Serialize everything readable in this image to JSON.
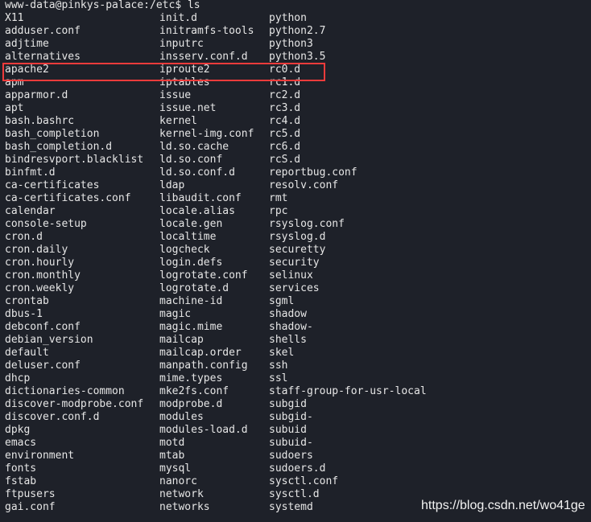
{
  "terminal": {
    "prompt": "www-data@pinkys-palace:/etc$ ls",
    "columns": [
      [
        "X11",
        "adduser.conf",
        "adjtime",
        "alternatives",
        "apache2",
        "apm",
        "apparmor.d",
        "apt",
        "bash.bashrc",
        "bash_completion",
        "bash_completion.d",
        "bindresvport.blacklist",
        "binfmt.d",
        "ca-certificates",
        "ca-certificates.conf",
        "calendar",
        "console-setup",
        "cron.d",
        "cron.daily",
        "cron.hourly",
        "cron.monthly",
        "cron.weekly",
        "crontab",
        "dbus-1",
        "debconf.conf",
        "debian_version",
        "default",
        "deluser.conf",
        "dhcp",
        "dictionaries-common",
        "discover-modprobe.conf",
        "discover.conf.d",
        "dpkg",
        "emacs",
        "environment",
        "fonts",
        "fstab",
        "ftpusers",
        "gai.conf"
      ],
      [
        "init.d",
        "initramfs-tools",
        "inputrc",
        "insserv.conf.d",
        "iproute2",
        "iptables",
        "issue",
        "issue.net",
        "kernel",
        "kernel-img.conf",
        "ld.so.cache",
        "ld.so.conf",
        "ld.so.conf.d",
        "ldap",
        "libaudit.conf",
        "locale.alias",
        "locale.gen",
        "localtime",
        "logcheck",
        "login.defs",
        "logrotate.conf",
        "logrotate.d",
        "machine-id",
        "magic",
        "magic.mime",
        "mailcap",
        "mailcap.order",
        "manpath.config",
        "mime.types",
        "mke2fs.conf",
        "modprobe.d",
        "modules",
        "modules-load.d",
        "motd",
        "mtab",
        "mysql",
        "nanorc",
        "network",
        "networks"
      ],
      [
        "python",
        "python2.7",
        "python3",
        "python3.5",
        "rc0.d",
        "rc1.d",
        "rc2.d",
        "rc3.d",
        "rc4.d",
        "rc5.d",
        "rc6.d",
        "rcS.d",
        "reportbug.conf",
        "resolv.conf",
        "rmt",
        "rpc",
        "rsyslog.conf",
        "rsyslog.d",
        "securetty",
        "security",
        "selinux",
        "services",
        "sgml",
        "shadow",
        "shadow-",
        "shells",
        "skel",
        "ssh",
        "ssl",
        "staff-group-for-usr-local",
        "subgid",
        "subgid-",
        "subuid",
        "subuid-",
        "sudoers",
        "sudoers.d",
        "sysctl.conf",
        "sysctl.d",
        "systemd"
      ]
    ],
    "highlighted_row": 3,
    "highlight_color": "#ef3b3b"
  },
  "watermark": "https://blog.csdn.net/wo41ge"
}
